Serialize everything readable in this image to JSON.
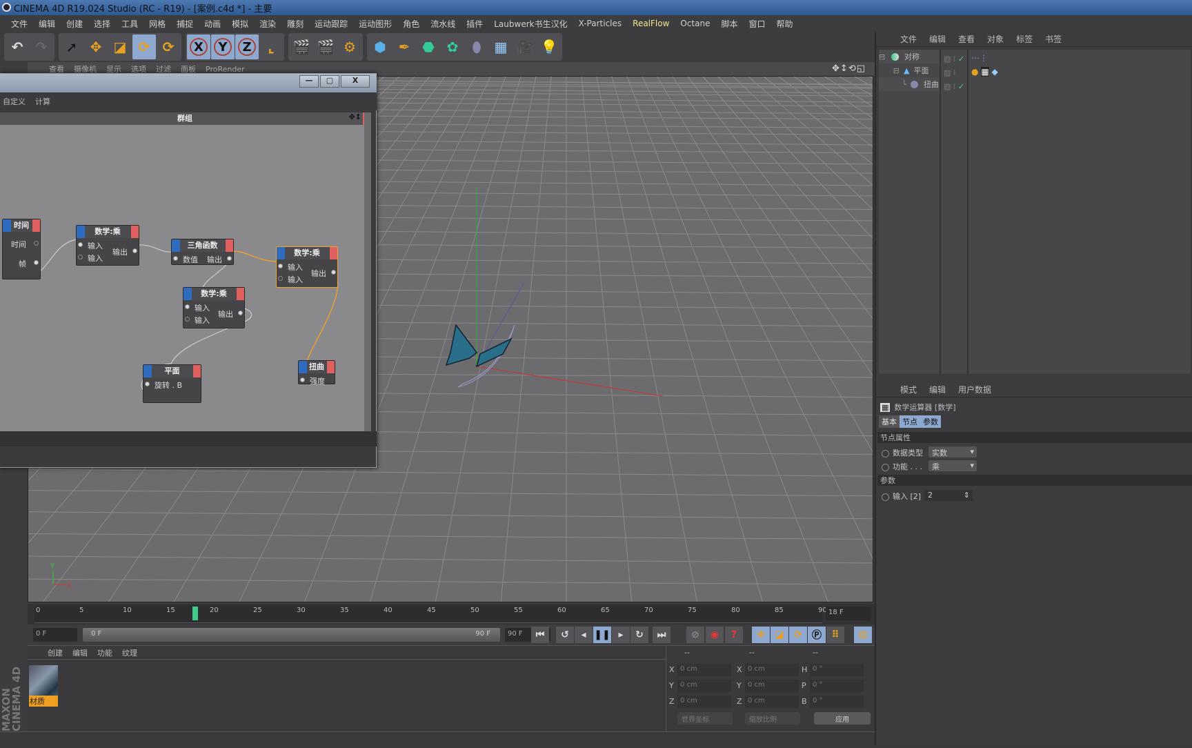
{
  "window_title": "CINEMA 4D R19.024 Studio (RC - R19) - [案例.c4d *] - 主要",
  "menu": [
    "文件",
    "编辑",
    "创建",
    "选择",
    "工具",
    "网格",
    "捕捉",
    "动画",
    "模拟",
    "渲染",
    "雕刻",
    "运动跟踪",
    "运动图形",
    "角色",
    "流水线",
    "插件",
    "Laubwerk书生汉化",
    "X-Particles",
    "RealFlow",
    "Octane",
    "脚本",
    "窗口",
    "帮助"
  ],
  "menu_highlight": "RealFlow",
  "toolbar_icons": [
    "undo-icon",
    "redo-icon",
    "select-icon",
    "move-icon",
    "scale-icon",
    "rotate-icon",
    "rotate-last-icon",
    "x-axis-icon",
    "y-axis-icon",
    "z-axis-icon",
    "coordinate-system-icon",
    "render-view-icon",
    "render-picture-viewer-icon",
    "render-settings-icon",
    "cube-icon",
    "pen-icon",
    "subdivision-icon",
    "cloner-icon",
    "deformer-icon",
    "floor-icon",
    "camera-icon",
    "light-icon"
  ],
  "toolbar_axis": [
    "X",
    "Y",
    "Z"
  ],
  "viewport": {
    "menu": [
      "查看",
      "摄像机",
      "显示",
      "选项",
      "过滤",
      "面板",
      "ProRender"
    ],
    "nav_icons": "✥↕⟲◱",
    "axis_labels": [
      "Y",
      "X"
    ]
  },
  "node_editor": {
    "menu": [
      "自定义",
      "计算"
    ],
    "group_title": "群组",
    "win_buttons": [
      "—",
      "▢",
      "X"
    ],
    "nodes": [
      {
        "title": "时间",
        "ports": [
          "时间",
          "帧"
        ]
      },
      {
        "title": "数学:乘",
        "inputs": [
          "输入",
          "输入"
        ],
        "output": "输出"
      },
      {
        "title": "三角函数",
        "inputs": [
          "数值"
        ],
        "output": "输出"
      },
      {
        "title": "数学:乘",
        "inputs": [
          "输入",
          "输入"
        ],
        "output": "输出",
        "selected": true
      },
      {
        "title": "数学:乘",
        "inputs": [
          "输入",
          "输入"
        ],
        "output": "输出"
      },
      {
        "title": "平面",
        "inputs": [
          "旋转 . B"
        ]
      },
      {
        "title": "扭曲",
        "inputs": [
          "强度"
        ]
      }
    ],
    "wire_color_selected": "#f0a030"
  },
  "timeline": {
    "ticks": [
      "0",
      "5",
      "10",
      "15",
      "20",
      "25",
      "30",
      "35",
      "40",
      "45",
      "50",
      "55",
      "60",
      "65",
      "70",
      "75",
      "80",
      "85",
      "90"
    ],
    "current_frame": 18,
    "current_frame_label": "18 F",
    "start": "0 F",
    "range_start": "0 F",
    "range_end": "90 F",
    "end": "90 F",
    "playhead_color": "#3ec98a"
  },
  "materials": {
    "menu": [
      "创建",
      "编辑",
      "功能",
      "纹理"
    ],
    "items": [
      {
        "name": "材质"
      }
    ]
  },
  "coordinates": {
    "headers": [
      "--",
      "--",
      "--"
    ],
    "rows": [
      {
        "a": "X",
        "av": "0 cm",
        "b": "X",
        "bv": "0 cm",
        "c": "H",
        "cv": "0 °"
      },
      {
        "a": "Y",
        "av": "0 cm",
        "b": "Y",
        "bv": "0 cm",
        "c": "P",
        "cv": "0 °"
      },
      {
        "a": "Z",
        "av": "0 cm",
        "b": "Z",
        "bv": "0 cm",
        "c": "B",
        "cv": "0 °"
      }
    ],
    "mode1": "世界坐标",
    "mode2": "缩放比例",
    "apply": "应用"
  },
  "object_manager": {
    "menu": [
      "文件",
      "编辑",
      "查看",
      "对象",
      "标签",
      "书签"
    ],
    "objects": [
      {
        "name": "对称"
      },
      {
        "name": "平面"
      },
      {
        "name": "扭曲"
      }
    ]
  },
  "attributes": {
    "menu": [
      "模式",
      "编辑",
      "用户数据"
    ],
    "title": "数学运算器 [数学]",
    "tabs": [
      "基本",
      "节点",
      "参数"
    ],
    "section1": "节点属性",
    "data_type_label": "数据类型",
    "data_type": "实数",
    "function_label": "功能 . . .",
    "function": "乘",
    "section2": "参数",
    "input_label": "输入 [2]",
    "input_value": "2"
  },
  "brand": "MAXON CINEMA 4D"
}
